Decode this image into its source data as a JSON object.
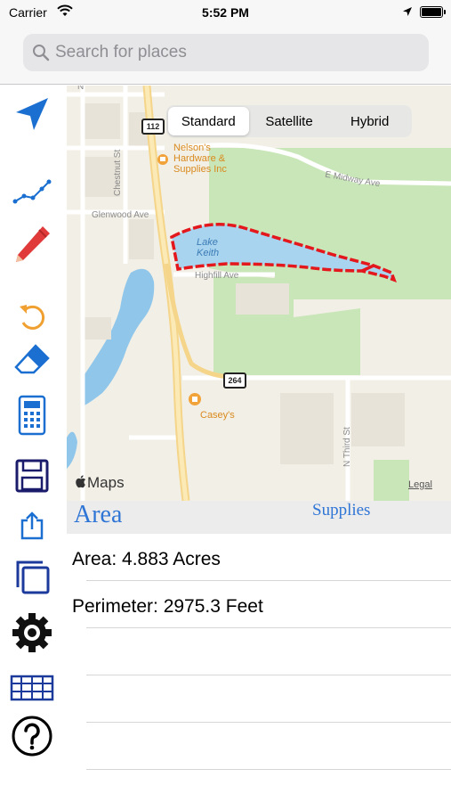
{
  "status_bar": {
    "carrier": "Carrier",
    "time": "5:52 PM"
  },
  "search": {
    "placeholder": "Search for places"
  },
  "toolbar": {
    "tools": [
      "location-arrow-icon",
      "line-graph-icon",
      "pencil-icon",
      "undo-icon",
      "eraser-icon",
      "calculator-icon",
      "save-icon",
      "share-icon",
      "copy-icon",
      "gear-icon",
      "table-icon",
      "help-icon"
    ]
  },
  "map": {
    "map_type": {
      "options": [
        "Standard",
        "Satellite",
        "Hybrid"
      ],
      "selected": "Standard"
    },
    "labels": {
      "street_chestnut": "Chestnut St",
      "street_glenwood": "Glenwood Ave",
      "street_highfill": "Highfill Ave",
      "street_midway": "E Midway Ave",
      "street_third": "N Third St",
      "street_partial": "N"
    },
    "pois": {
      "nelsons": "Nelson's Hardware & Supplies Inc",
      "caseys": "Casey's"
    },
    "lake": "Lake Keith",
    "shields": {
      "route_112": "112",
      "route_264": "264"
    },
    "attribution": "Maps",
    "legal": "Legal"
  },
  "results": {
    "title": "Area",
    "supplies_link": "Supplies",
    "rows": [
      "Area: 4.883 Acres",
      "Perimeter: 2975.3 Feet",
      "",
      "",
      ""
    ]
  },
  "colors": {
    "accent_blue": "#2f75d6",
    "toolbar_blue": "#1a6fd1",
    "pencil_red": "#e03a3a",
    "undo_orange": "#f0a030",
    "polygon_stroke": "#e3171c",
    "polygon_fill": "#a8d4ef",
    "park_green": "#c9e6b8"
  }
}
